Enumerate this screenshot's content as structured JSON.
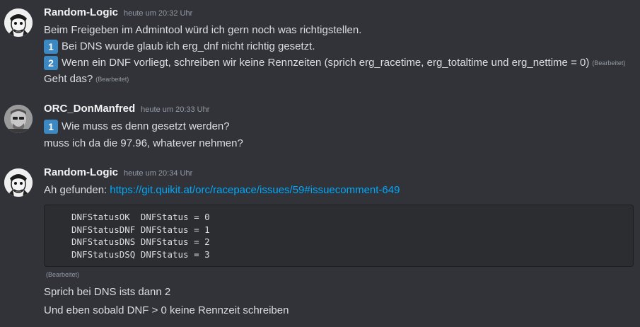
{
  "messages": [
    {
      "author": "Random-Logic",
      "time": "heute um 20:32 Uhr",
      "lines": [
        {
          "text": "Beim Freigeben im Admintool würd ich gern noch was richtigstellen."
        },
        {
          "badge": "1",
          "text": "Bei DNS wurde glaub ich erg_dnf nicht richtig gesetzt."
        },
        {
          "badge": "2",
          "text": "Wenn ein DNF vorliegt, schreiben wir keine Rennzeiten (sprich erg_racetime, erg_totaltime und erg_nettime = 0)",
          "edited": "(Bearbeitet)"
        },
        {
          "text": "Geht das?",
          "edited": "(Bearbeitet)"
        }
      ]
    },
    {
      "author": "ORC_DonManfred",
      "time": "heute um 20:33 Uhr",
      "lines": [
        {
          "badge": "1",
          "text": "Wie muss es denn gesetzt werden?"
        },
        {
          "text": "muss ich da die 97.96, whatever nehmen?"
        }
      ]
    },
    {
      "author": "Random-Logic",
      "time": "heute um 20:34 Uhr",
      "found_text": "Ah gefunden:",
      "link": "https://git.quikit.at/orc/racepace/issues/59#issuecomment-649",
      "code": [
        "DNFStatusOK  DNFStatus = 0",
        "DNFStatusDNF DNFStatus = 1",
        "DNFStatusDNS DNFStatus = 2",
        "DNFStatusDSQ DNFStatus = 3"
      ],
      "code_edited": "(Bearbeitet)",
      "after_lines": [
        {
          "text": "Sprich bei DNS ists dann 2"
        },
        {
          "text": "Und eben sobald DNF > 0 keine Rennzeit schreiben"
        }
      ]
    }
  ],
  "colors": {
    "background": "#313338",
    "link": "#00a8fc",
    "badge": "#3b88c3",
    "code_background": "#2b2d31"
  }
}
